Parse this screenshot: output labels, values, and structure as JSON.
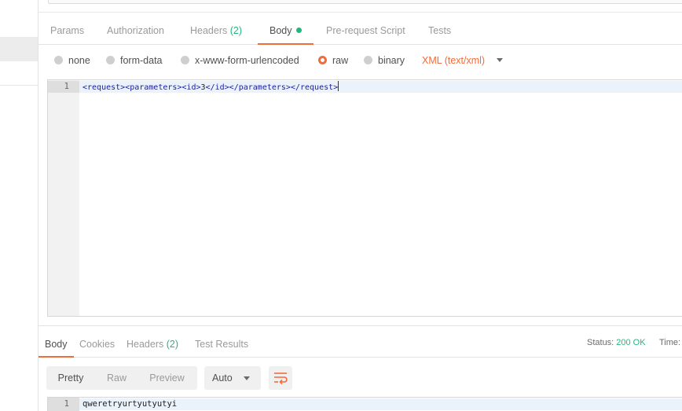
{
  "request_tabs": {
    "params": "Params",
    "authorization": "Authorization",
    "headers": "Headers",
    "headers_count": "(2)",
    "body": "Body",
    "prerequest": "Pre-request Script",
    "tests": "Tests"
  },
  "body_types": {
    "none": "none",
    "form_data": "form-data",
    "urlencoded": "x-www-form-urlencoded",
    "raw": "raw",
    "binary": "binary",
    "selected": "raw",
    "content_type": "XML (text/xml)"
  },
  "request_editor": {
    "line_number": "1",
    "tags": [
      "<request>",
      "<parameters>",
      "<id>",
      "</id>",
      "</parameters>",
      "</request>"
    ],
    "id_value": "3"
  },
  "response_tabs": {
    "body": "Body",
    "cookies": "Cookies",
    "headers": "Headers",
    "headers_count": "(2)",
    "test_results": "Test Results"
  },
  "response_status": {
    "label": "Status:",
    "value": "200 OK",
    "time_label": "Time:"
  },
  "response_toolbar": {
    "pretty": "Pretty",
    "raw": "Raw",
    "preview": "Preview",
    "format": "Auto"
  },
  "response_editor": {
    "line_number": "1",
    "content": "qweretryurtyutyutyi"
  },
  "colors": {
    "accent": "#f26b3a",
    "success": "#26b47f"
  },
  "icons": {
    "wrap": "wrap-lines-icon",
    "dropdown": "chevron-down-icon"
  }
}
